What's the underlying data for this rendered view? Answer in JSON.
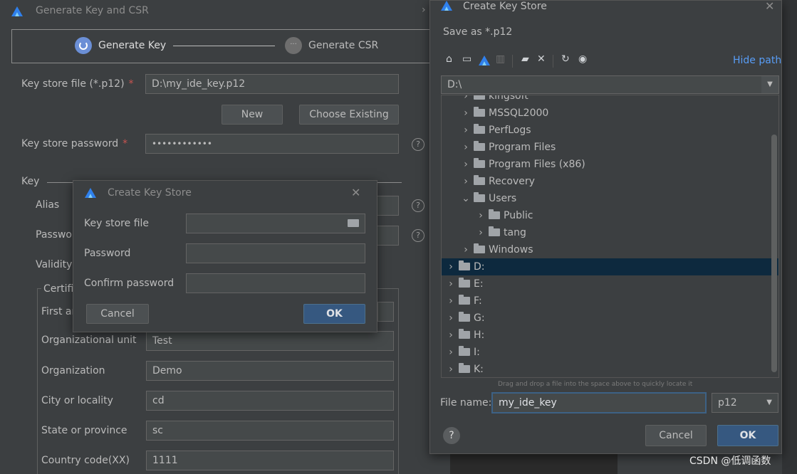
{
  "main_dialog": {
    "title": "Generate Key and CSR",
    "steps": [
      {
        "label": "Generate Key"
      },
      {
        "label": "Generate CSR"
      }
    ],
    "keystore_file_label": "Key store file (*.p12)",
    "keystore_file_value": "D:\\my_ide_key.p12",
    "new_button": "New",
    "choose_existing_button": "Choose Existing",
    "keystore_password_label": "Key store password",
    "keystore_password_value": "••••••••••••",
    "required_mark": "*",
    "key_section_label": "Key",
    "alias_label": "Alias",
    "password_label": "Passwo",
    "validity_label": "Validity",
    "certificate_label": "Certifi",
    "first_label": "First ar",
    "org_unit_label": "Organizational unit",
    "org_unit_value": "Test",
    "organization_label": "Organization",
    "organization_value": "Demo",
    "city_label": "City or locality",
    "city_value": "cd",
    "state_label": "State or province",
    "state_value": "sc",
    "country_label": "Country code(XX)",
    "country_value": "1111",
    "help_glyph": "?"
  },
  "small_dialog": {
    "title": "Create Key Store",
    "keystore_file_label": "Key store file",
    "password_label": "Password",
    "confirm_password_label": "Confirm password",
    "cancel_button": "Cancel",
    "ok_button": "OK"
  },
  "file_dialog": {
    "title": "Create Key Store",
    "save_as": "Save as *.p12",
    "hide_path": "Hide path",
    "path_value": "D:\\",
    "tree": [
      {
        "label": "kingsoft",
        "indent": 1,
        "expanded": false
      },
      {
        "label": "MSSQL2000",
        "indent": 1,
        "expanded": false
      },
      {
        "label": "PerfLogs",
        "indent": 1,
        "expanded": false
      },
      {
        "label": "Program Files",
        "indent": 1,
        "expanded": false
      },
      {
        "label": "Program Files (x86)",
        "indent": 1,
        "expanded": false
      },
      {
        "label": "Recovery",
        "indent": 1,
        "expanded": false
      },
      {
        "label": "Users",
        "indent": 1,
        "expanded": true
      },
      {
        "label": "Public",
        "indent": 2,
        "expanded": false
      },
      {
        "label": "tang",
        "indent": 2,
        "expanded": false
      },
      {
        "label": "Windows",
        "indent": 1,
        "expanded": false
      },
      {
        "label": "D:",
        "indent": 0,
        "expanded": false,
        "selected": true
      },
      {
        "label": "E:",
        "indent": 0,
        "expanded": false
      },
      {
        "label": "F:",
        "indent": 0,
        "expanded": false
      },
      {
        "label": "G:",
        "indent": 0,
        "expanded": false
      },
      {
        "label": "H:",
        "indent": 0,
        "expanded": false
      },
      {
        "label": "I:",
        "indent": 0,
        "expanded": false
      },
      {
        "label": "K:",
        "indent": 0,
        "expanded": false
      }
    ],
    "drag_hint": "Drag and drop a file into the space above to quickly locate it",
    "file_name_label": "File name:",
    "file_name_value": "my_ide_key",
    "extension_value": "p12",
    "cancel_button": "Cancel",
    "ok_button": "OK",
    "help_glyph": "?"
  },
  "watermark": "CSDN @低调函数",
  "colors": {
    "background": "#3c3f41",
    "selected_row": "#0d293e",
    "primary_button": "#365880",
    "link": "#589df6",
    "required": "#c75450"
  }
}
